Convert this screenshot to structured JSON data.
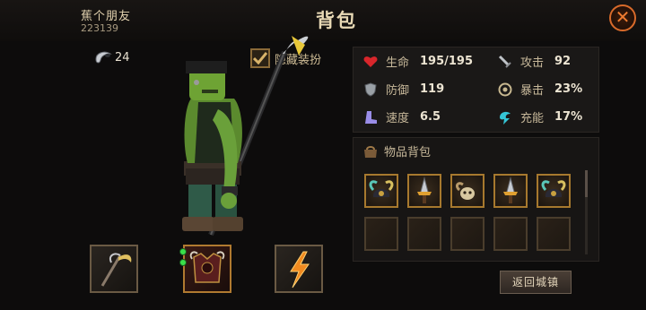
{
  "header": {
    "player_name": "蕉个朋友",
    "player_id": "223139",
    "title": "背包",
    "close_icon": "close-x-icon"
  },
  "currency": {
    "icon": "horn-icon",
    "value": "24"
  },
  "hide_outfit": {
    "label": "隐藏装扮",
    "checked": true
  },
  "equipment": [
    {
      "slot": "weapon",
      "icon": "scythe-icon"
    },
    {
      "slot": "armor",
      "icon": "chest-armor-icon"
    },
    {
      "slot": "rune",
      "icon": "lightning-icon"
    }
  ],
  "stats": {
    "hp": {
      "label": "生命",
      "value": "195/195",
      "icon": "heart-icon",
      "color": "#d8262b"
    },
    "attack": {
      "label": "攻击",
      "value": "92",
      "icon": "sword-icon"
    },
    "defense": {
      "label": "防御",
      "value": "119",
      "icon": "shield-icon"
    },
    "crit": {
      "label": "暴击",
      "value": "23%",
      "icon": "crit-icon"
    },
    "speed": {
      "label": "速度",
      "value": "6.5",
      "icon": "boot-icon",
      "color": "#9a8de8"
    },
    "energy": {
      "label": "充能",
      "value": "17%",
      "icon": "energy-icon",
      "color": "#35c6d6"
    }
  },
  "bag": {
    "title": "物品背包",
    "icon": "bag-icon",
    "items": [
      {
        "icon": "horned-helmet-icon"
      },
      {
        "icon": "gold-dagger-icon"
      },
      {
        "icon": "sheep-skull-icon"
      },
      {
        "icon": "gold-dagger-icon"
      },
      {
        "icon": "horned-helmet-icon"
      }
    ],
    "empty_slots": 5
  },
  "return_button": {
    "label": "返回城镇"
  },
  "colors": {
    "accent": "#d86a2a",
    "gold_border": "#a7792e",
    "panel_bg": "#1a1817"
  }
}
